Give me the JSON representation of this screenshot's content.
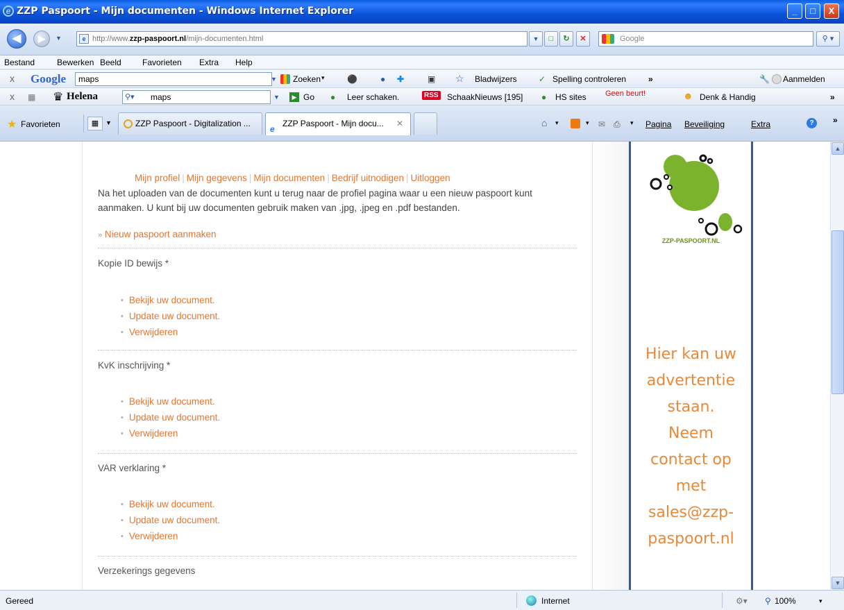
{
  "window": {
    "title": "ZZP Paspoort - Mijn documenten - Windows Internet Explorer",
    "minimize": "_",
    "maximize": "□",
    "close": "X"
  },
  "address": {
    "url_prefix": "http://www.",
    "url_domain": "zzp-paspoort.nl",
    "url_path": "/mijn-documenten.html",
    "search_placeholder": "Google"
  },
  "menu": [
    "Bestand",
    "Bewerken",
    "Beeld",
    "Favorieten",
    "Extra",
    "Help"
  ],
  "google_toolbar": {
    "logo": "Google",
    "query": "maps",
    "search": "Zoeken",
    "bookmarks": "Bladwijzers",
    "spellcheck": "Spelling controleren",
    "more": "»",
    "signin": "Aanmelden"
  },
  "helena_toolbar": {
    "logo": "Helena",
    "query": "maps",
    "go": "Go",
    "chess": "Leer schaken.",
    "rss": "RSS",
    "news": "SchaakNieuws [195]",
    "hs": "HS sites",
    "turn": "Geen beurt!",
    "denk": "Denk & Handig",
    "more": "»"
  },
  "tabs": {
    "favorites": "Favorieten",
    "tab1": "ZZP Paspoort - Digitalization ...",
    "tab2": "ZZP Paspoort - Mijn docu...",
    "pagina": "Pagina",
    "beveiliging": "Beveiliging",
    "extra": "Extra",
    "more": "»"
  },
  "page": {
    "nav": [
      "Mijn profiel",
      "Mijn gegevens",
      "Mijn documenten",
      "Bedrijf uitnodigen",
      "Uitloggen"
    ],
    "intro_line1": "Na het uploaden van de documenten kunt u terug naar de profiel pagina waar u een nieuw paspoort kunt",
    "intro_line2": "aanmaken. U kunt bij uw documenten gebruik maken van .jpg, .jpeg en .pdf bestanden.",
    "new_passport_prefix": "»",
    "new_passport": "Nieuw paspoort aanmaken",
    "sections": [
      {
        "title": "Kopie ID bewijs *",
        "links": [
          "Bekijk uw document.",
          "Update uw document.",
          "Verwijderen"
        ]
      },
      {
        "title": "KvK inschrijving *",
        "links": [
          "Bekijk uw document.",
          "Update uw document.",
          "Verwijderen"
        ]
      },
      {
        "title": "VAR verklaring *",
        "links": [
          "Bekijk uw document.",
          "Update uw document.",
          "Verwijderen"
        ]
      },
      {
        "title": "Verzekerings gegevens",
        "links": []
      }
    ]
  },
  "ad": {
    "brand": "ZZP-PASPOORT.NL",
    "lines": [
      "Hier kan uw",
      "advertentie",
      "staan.",
      "Neem",
      "contact op",
      "met",
      "sales@zzp-",
      "paspoort.nl"
    ]
  },
  "status": {
    "text": "Gereed",
    "zone": "Internet",
    "zoom": "100%"
  },
  "colors": {
    "link_orange": "#e8752d",
    "ad_green": "#7bb32e",
    "ad_border": "#3e5b79"
  }
}
